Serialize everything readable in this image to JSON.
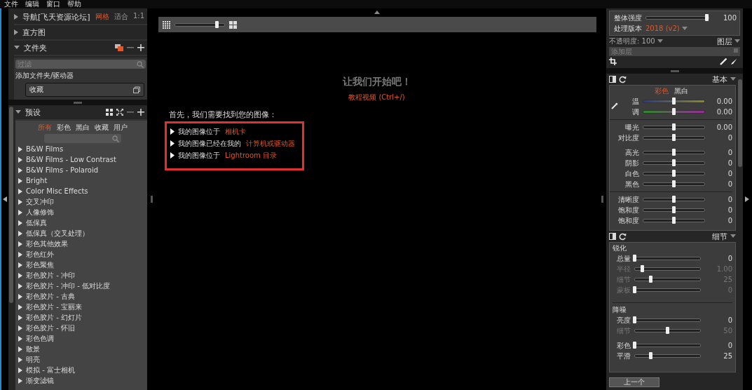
{
  "menu": [
    "文件",
    "编辑",
    "窗口",
    "帮助"
  ],
  "left": {
    "navigator": {
      "title": "导航[飞天资源论坛]",
      "expanded": false,
      "modes": [
        {
          "label": "网格",
          "selected": true
        },
        {
          "label": "适合",
          "selected": false
        },
        {
          "label": "1:1",
          "selected": false
        }
      ]
    },
    "histogram": {
      "title": "直方图",
      "expanded": false
    },
    "folders": {
      "title": "文件夹",
      "expanded": true,
      "filter_placeholder": "过滤",
      "add_label": "添加文件夹/驱动器",
      "favorites": "收藏"
    },
    "presets": {
      "title": "预设",
      "expanded": true,
      "tabs": [
        {
          "label": "所有",
          "selected": true
        },
        {
          "label": "彩色",
          "selected": false
        },
        {
          "label": "黑白",
          "selected": false
        },
        {
          "label": "收藏",
          "selected": false
        },
        {
          "label": "用户",
          "selected": false
        }
      ],
      "items": [
        "B&W Films",
        "B&W Films - Low Contrast",
        "B&W Films - Polaroid",
        "Bright",
        "Color Misc Effects",
        "交叉冲印",
        "人像修饰",
        "低保真",
        "低保真（交叉处理）",
        "彩色其他效果",
        "彩色红外",
        "彩色聚焦",
        "彩色胶片 - 冲印",
        "彩色胶片 - 冲印 - 低对比度",
        "彩色胶片 - 古典",
        "彩色胶片 - 宝丽来",
        "彩色胶片 - 幻灯片",
        "彩色胶片 - 怀旧",
        "彩色色调",
        "散景",
        "明亮",
        "模拟 - 富士相机",
        "渐变滤镜"
      ]
    }
  },
  "center": {
    "thumb_size": {
      "level": 0.85
    },
    "title": "让我们开始吧！",
    "tutorial_link": "教程视频 (Ctrl+/)",
    "prompt": "首先，我们需要找到您的图像：",
    "options": [
      {
        "text": "我的图像位于",
        "link": "相机卡"
      },
      {
        "text": "我的图像已经在我的",
        "link": "计算机或驱动器"
      },
      {
        "text": "我的图像位于",
        "link": "Lightroom 目录"
      }
    ]
  },
  "right": {
    "strength": {
      "label": "整体强度",
      "level": 0.98,
      "value": "100"
    },
    "process_version": {
      "label": "处理版本",
      "value": "2018 (v2)"
    },
    "opacity": "不透明度: 100",
    "layers_title": "图层",
    "add_layer_placeholder": "添加层",
    "basic": {
      "title": "基本",
      "modes": [
        {
          "label": "彩色",
          "selected": true
        },
        {
          "label": "黑白",
          "selected": false
        }
      ],
      "groups": [
        {
          "rule_after": true,
          "sliders": [
            {
              "label": "温",
              "kind": "temperature",
              "level": 0.5,
              "value": "0.00",
              "disabled": false
            },
            {
              "label": "调",
              "kind": "tint",
              "level": 0.5,
              "value": "0.00",
              "disabled": false
            }
          ]
        },
        {
          "rule_after": false,
          "sliders": [
            {
              "label": "曝光",
              "kind": "plain",
              "level": 0.5,
              "value": "0.00",
              "disabled": false
            },
            {
              "label": "对比度",
              "kind": "plain",
              "level": 0.5,
              "value": "0",
              "disabled": false
            }
          ]
        },
        {
          "rule_after": true,
          "sliders": [
            {
              "label": "高光",
              "kind": "plain",
              "level": 0.5,
              "value": "0",
              "disabled": false
            },
            {
              "label": "阴影",
              "kind": "plain",
              "level": 0.5,
              "value": "0",
              "disabled": false
            },
            {
              "label": "白色",
              "kind": "plain",
              "level": 0.5,
              "value": "0",
              "disabled": false
            },
            {
              "label": "黑色",
              "kind": "plain",
              "level": 0.5,
              "value": "0",
              "disabled": false
            }
          ]
        },
        {
          "rule_after": false,
          "sliders": [
            {
              "label": "清晰度",
              "kind": "plain",
              "level": 0.5,
              "value": "0",
              "disabled": false
            },
            {
              "label": "饱和度",
              "kind": "plain",
              "level": 0.5,
              "value": "0",
              "disabled": false
            },
            {
              "label": "饱和度",
              "kind": "plain",
              "level": 0.5,
              "value": "0",
              "disabled": false
            }
          ]
        }
      ]
    },
    "detail": {
      "title": "细节",
      "sections": [
        {
          "title": "锐化",
          "rule_after": true,
          "groups": [
            [
              {
                "label": "总量",
                "level": 0,
                "value": "0",
                "disabled": false
              },
              {
                "label": "半径",
                "level": 0.12,
                "value": "1.00",
                "disabled": true
              },
              {
                "label": "细节",
                "level": 0.25,
                "value": "25",
                "disabled": true
              },
              {
                "label": "蒙板",
                "level": 0,
                "value": "0",
                "disabled": true
              }
            ]
          ]
        },
        {
          "title": "降噪",
          "rule_after": false,
          "groups": [
            [
              {
                "label": "亮度",
                "level": 0,
                "value": "0",
                "disabled": false
              },
              {
                "label": "细节",
                "level": 0.5,
                "value": "50",
                "disabled": true
              }
            ],
            [
              {
                "label": "彩色",
                "level": 0,
                "value": "0",
                "disabled": false
              },
              {
                "label": "平滑",
                "level": 0.25,
                "value": "25",
                "disabled": false
              }
            ]
          ]
        }
      ]
    },
    "bottom_button": "上一个"
  }
}
